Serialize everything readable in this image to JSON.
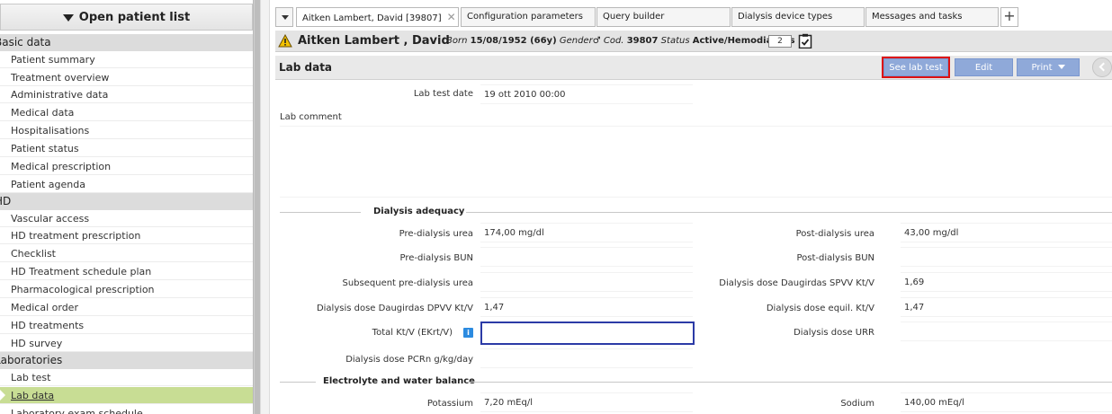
{
  "sidebar": {
    "open_list_label": "Open patient list",
    "sections": [
      {
        "label": "Basic data",
        "items": [
          "Patient summary",
          "Treatment overview",
          "Administrative data",
          "Medical data",
          "Hospitalisations",
          "Patient status",
          "Medical prescription",
          "Patient agenda"
        ]
      },
      {
        "label": "HD",
        "items": [
          "Vascular access",
          "HD treatment prescription",
          "Checklist",
          "HD Treatment schedule plan",
          "Pharmacological prescription",
          "Medical order",
          "HD treatments",
          "HD survey"
        ]
      },
      {
        "label": "Laboratories",
        "items": [
          "Lab test",
          "Lab data",
          "Laboratory exam schedule"
        ]
      }
    ],
    "active_item": "Lab data"
  },
  "tabs": {
    "items": [
      {
        "label": "Aitken Lambert, David [39807]",
        "closable": true
      },
      {
        "label": "Configuration parameters"
      },
      {
        "label": "Query builder"
      },
      {
        "label": "Dialysis device types"
      },
      {
        "label": "Messages and tasks"
      }
    ],
    "add_label": "+"
  },
  "patient": {
    "name": "Aitken Lambert , David",
    "born_label": "Born",
    "born_value": "15/08/1952 (66y)",
    "gender_label": "Gender",
    "gender_symbol": "♂",
    "cod_label": "Cod.",
    "cod_value": "39807",
    "status_label": "Status",
    "status_value": "Active/Hemodialysis",
    "badge": "2"
  },
  "lab": {
    "title": "Lab data",
    "see_label": "See lab test ...",
    "edit_label": "Edit",
    "print_label": "Print",
    "test_date_label": "Lab test date",
    "test_date_value": "19 ott 2010 00:00",
    "comment_label": "Lab comment",
    "group1": "Dialysis adequacy",
    "group2": "Electrolyte and water balance",
    "left": [
      {
        "label": "Pre-dialysis urea",
        "value": "174,00 mg/dl"
      },
      {
        "label": "Pre-dialysis BUN",
        "value": ""
      },
      {
        "label": "Subsequent pre-dialysis urea",
        "value": ""
      },
      {
        "label": "Dialysis dose Daugirdas DPVV Kt/V",
        "value": "1,47"
      },
      {
        "label": "Total Kt/V (EKrt/V)",
        "value": ""
      },
      {
        "label": "Dialysis dose PCRn g/kg/day",
        "value": ""
      }
    ],
    "right": [
      {
        "label": "Post-dialysis urea",
        "value": "43,00 mg/dl"
      },
      {
        "label": "Post-dialysis BUN",
        "value": ""
      },
      {
        "label": "Dialysis dose Daugirdas SPVV Kt/V",
        "value": "1,69"
      },
      {
        "label": "Dialysis dose equil. Kt/V",
        "value": "1,47"
      },
      {
        "label": "Dialysis dose URR",
        "value": ""
      }
    ],
    "potassium_label": "Potassium",
    "potassium_value": "7,20 mEq/l",
    "sodium_label": "Sodium",
    "sodium_value": "140,00 mEq/l"
  }
}
